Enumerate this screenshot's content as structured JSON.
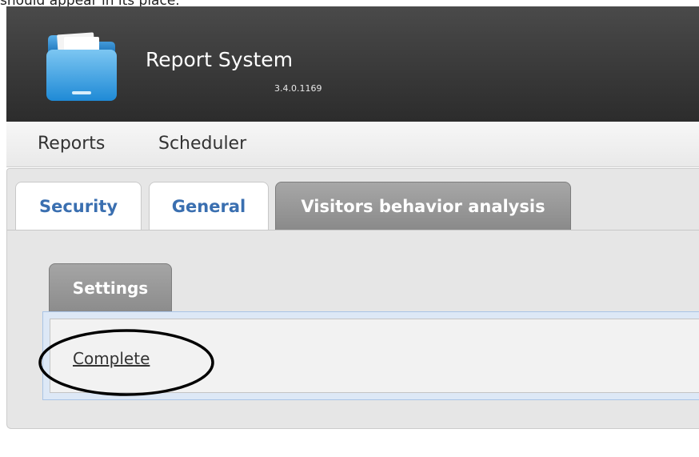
{
  "caption": "should appear in its place.",
  "header": {
    "title": "Report System",
    "version": "3.4.0.1169",
    "logo_icon": "folder-icon"
  },
  "menu": {
    "items": [
      {
        "label": "Reports"
      },
      {
        "label": "Scheduler"
      }
    ]
  },
  "tabs": [
    {
      "label": "Security",
      "active": false
    },
    {
      "label": "General",
      "active": false
    },
    {
      "label": "Visitors behavior analysis",
      "active": true
    }
  ],
  "subtabs": [
    {
      "label": "Settings",
      "active": true
    }
  ],
  "panel": {
    "link_label": "Complete"
  },
  "colors": {
    "header_bg": "#3a3a3a",
    "tab_text": "#3a6fb0",
    "active_tab_bg": "#999999",
    "panel_border": "#a9c4e6"
  }
}
